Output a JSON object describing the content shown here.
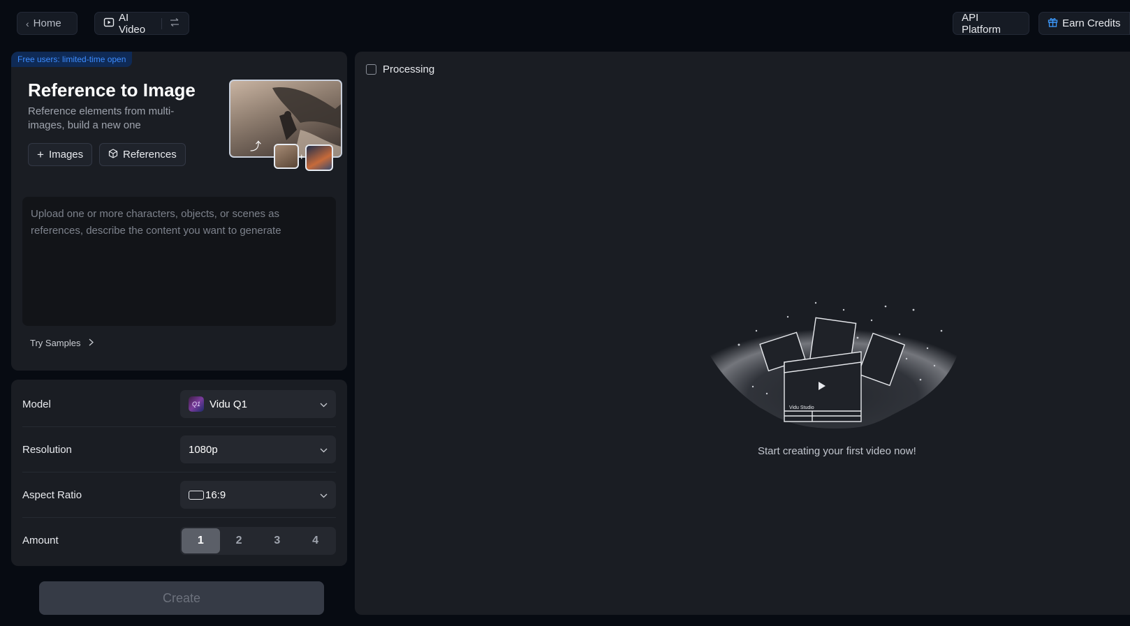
{
  "topbar": {
    "home_label": "Home",
    "mode_label": "AI Video",
    "api_label": "API Platform",
    "earn_label": "Earn Credits"
  },
  "reference": {
    "badge": "Free users: limited-time open",
    "title": "Reference to Image",
    "subtitle": "Reference elements from multi-images, build a new one",
    "images_label": "Images",
    "references_label": "References"
  },
  "prompt": {
    "placeholder": "Upload one or more characters, objects, or scenes as references, describe the content you want to generate",
    "try_samples": "Try Samples"
  },
  "settings": {
    "model_label": "Model",
    "model_value": "Vidu Q1",
    "model_logo_text": "Q1",
    "resolution_label": "Resolution",
    "resolution_value": "1080p",
    "aspect_label": "Aspect Ratio",
    "aspect_value": "16:9",
    "amount_label": "Amount",
    "amount_options": [
      "1",
      "2",
      "3",
      "4"
    ],
    "amount_selected": "1"
  },
  "create_label": "Create",
  "right": {
    "processing_label": "Processing",
    "empty_text": "Start creating your first video now!",
    "illustration_text": "Vidu Studio"
  },
  "colors": {
    "background": "#070b12",
    "panel": "#1a1d23",
    "badge_text": "#3d8cff",
    "earn_icon": "#3d9bff"
  }
}
